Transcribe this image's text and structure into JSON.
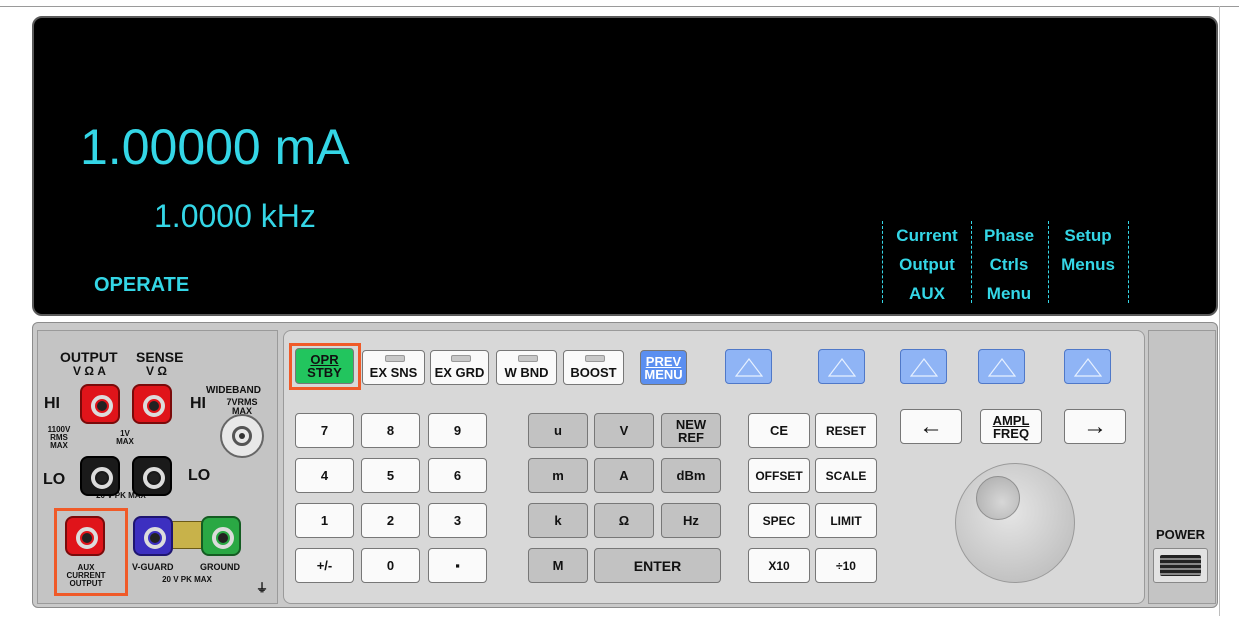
{
  "display": {
    "main_reading": "1.00000 mA",
    "frequency": "1.0000 kHz",
    "status": "OPERATE",
    "softkey_labels": [
      {
        "line1": "Current",
        "line2": "Output",
        "line3": "AUX"
      },
      {
        "line1": "Phase",
        "line2": "Ctrls",
        "line3": "Menu"
      },
      {
        "line1": "Setup",
        "line2": "Menus",
        "line3": ""
      }
    ]
  },
  "terminals": {
    "output_label": "OUTPUT",
    "output_sub": "V Ω A",
    "sense_label": "SENSE",
    "sense_sub": "V Ω",
    "hi_left": "HI",
    "hi_right": "HI",
    "lo_left": "LO",
    "lo_right": "LO",
    "rating_1100v": "1100V RMS MAX",
    "rating_1v": "1V MAX",
    "rating_20vpk": "20 V PK MAX",
    "wideband_label": "WIDEBAND",
    "wideband_rating": "7VRMS MAX",
    "aux_label": "AUX CURRENT OUTPUT",
    "vguard_label": "V-GUARD",
    "ground_label": "GROUND",
    "rating_20vpk_bottom": "20 V PK MAX",
    "ground_symbol": "⏚"
  },
  "top_keys": {
    "opr_line1": "OPR",
    "opr_line2": "STBY",
    "ex_sns": "EX SNS",
    "ex_grd": "EX GRD",
    "w_bnd": "W BND",
    "boost": "BOOST",
    "prev_line1": "PREV",
    "prev_line2": "MENU"
  },
  "numeric_keys": [
    "7",
    "8",
    "9",
    "4",
    "5",
    "6",
    "1",
    "2",
    "3",
    "+/-",
    "0",
    "▪"
  ],
  "unit_keys": {
    "u": "u",
    "v": "V",
    "new_ref_line1": "NEW",
    "new_ref_line2": "REF",
    "m": "m",
    "a": "A",
    "dbm": "dBm",
    "k": "k",
    "ohm": "Ω",
    "hz": "Hz",
    "mega": "M",
    "enter": "ENTER"
  },
  "function_keys": {
    "ce": "CE",
    "reset": "RESET",
    "offset": "OFFSET",
    "scale": "SCALE",
    "spec": "SPEC",
    "limit": "LIMIT",
    "x10": "X10",
    "div10": "÷10"
  },
  "nav_keys": {
    "left_arrow": "←",
    "ampl_line1": "AMPL",
    "ampl_line2": "FREQ",
    "right_arrow": "→"
  },
  "power_label": "POWER",
  "colors": {
    "display_text": "#34d6e6",
    "opr_key": "#22c55e",
    "prev_key": "#5b8ff0",
    "softkey": "#8fb4f5",
    "highlight": "#f05a28"
  }
}
